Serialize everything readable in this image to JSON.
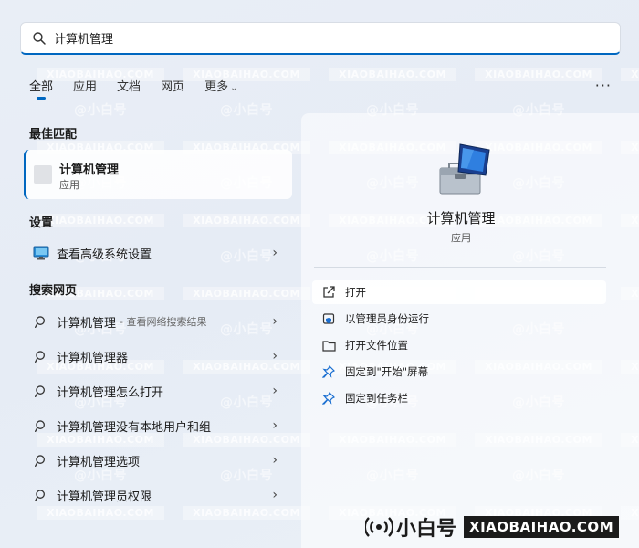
{
  "search": {
    "value": "计算机管理",
    "placeholder": ""
  },
  "tabs": [
    {
      "label": "全部",
      "active": true
    },
    {
      "label": "应用",
      "active": false
    },
    {
      "label": "文档",
      "active": false
    },
    {
      "label": "网页",
      "active": false
    },
    {
      "label": "更多",
      "active": false
    }
  ],
  "more_menu": "···",
  "best_match": {
    "section_title": "最佳匹配",
    "name": "计算机管理",
    "type": "应用"
  },
  "settings": {
    "section_title": "设置",
    "items": [
      {
        "label": "查看高级系统设置",
        "icon": "system-settings-icon"
      }
    ]
  },
  "web": {
    "section_title": "搜索网页",
    "items": [
      {
        "label": "计算机管理",
        "sub": "- 查看网络搜索结果"
      },
      {
        "label": "计算机管理器",
        "sub": ""
      },
      {
        "label": "计算机管理怎么打开",
        "sub": ""
      },
      {
        "label": "计算机管理没有本地用户和组",
        "sub": ""
      },
      {
        "label": "计算机管理选项",
        "sub": ""
      },
      {
        "label": "计算机管理员权限",
        "sub": ""
      }
    ]
  },
  "detail": {
    "title": "计算机管理",
    "type": "应用",
    "actions": [
      {
        "label": "打开",
        "icon": "open-external-icon"
      },
      {
        "label": "以管理员身份运行",
        "icon": "shield-icon"
      },
      {
        "label": "打开文件位置",
        "icon": "folder-icon"
      },
      {
        "label": "固定到\"开始\"屏幕",
        "icon": "pin-icon"
      },
      {
        "label": "固定到任务栏",
        "icon": "pin-icon"
      }
    ]
  },
  "watermark": {
    "cn": "@小白号",
    "en": "XIAOBAIHAO.COM"
  },
  "brand": {
    "cn": "小白号",
    "en": "XIAOBAIHAO.COM"
  },
  "colors": {
    "accent": "#0067c0",
    "icon_blue": "#1a6fd1"
  }
}
